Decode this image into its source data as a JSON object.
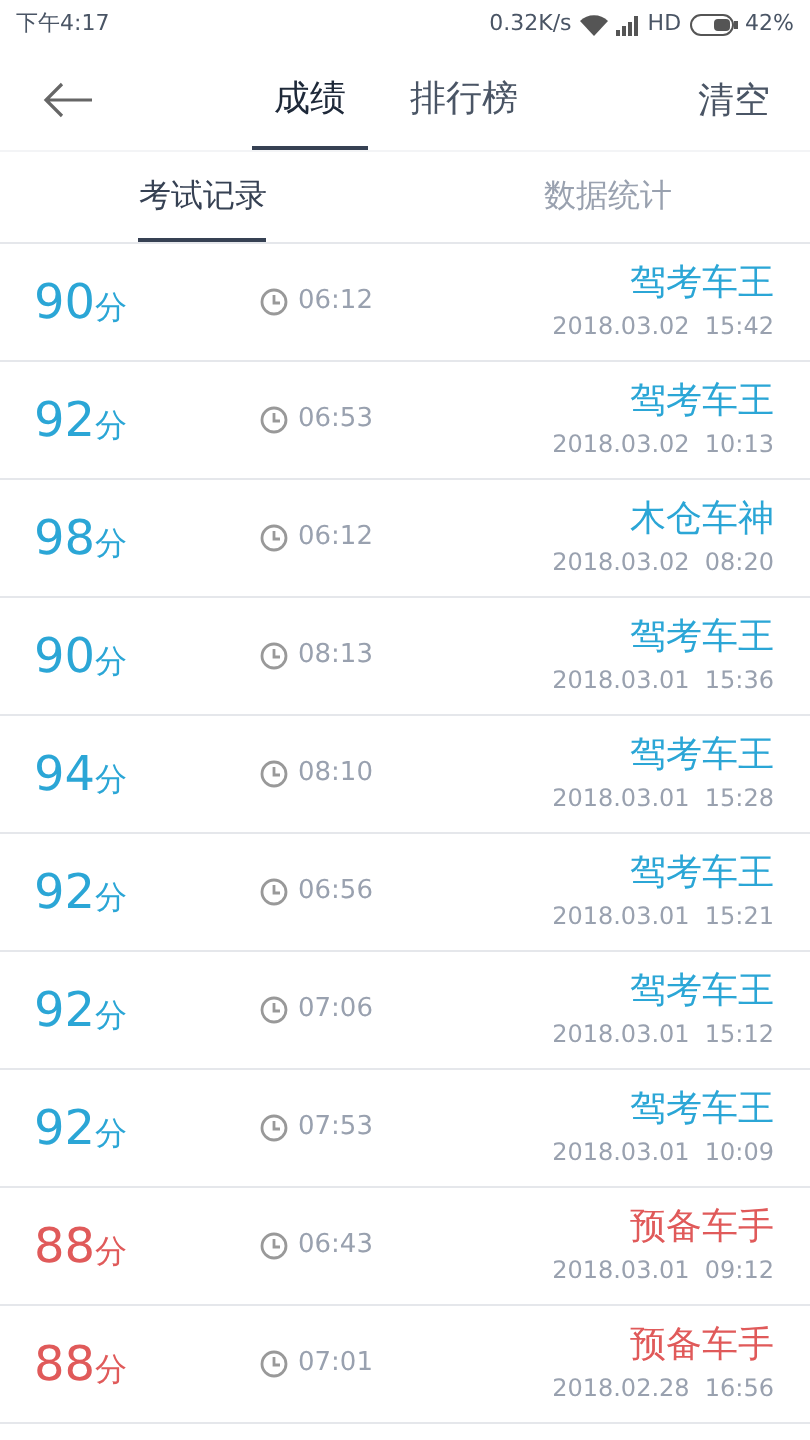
{
  "status_bar": {
    "time": "下午4:17",
    "speed": "0.32K/s",
    "network": "HD",
    "battery": "42%"
  },
  "header": {
    "tabs": [
      {
        "label": "成绩",
        "selected": true
      },
      {
        "label": "排行榜",
        "selected": false
      }
    ],
    "action": "清空"
  },
  "sub_tabs": [
    {
      "label": "考试记录",
      "selected": true
    },
    {
      "label": "数据统计",
      "selected": false
    }
  ],
  "records": [
    {
      "score": "90",
      "unit": "分",
      "duration": "06:12",
      "rank": "驾考车王",
      "date": "2018.03.02  15:42",
      "passed": true
    },
    {
      "score": "92",
      "unit": "分",
      "duration": "06:53",
      "rank": "驾考车王",
      "date": "2018.03.02  10:13",
      "passed": true
    },
    {
      "score": "98",
      "unit": "分",
      "duration": "06:12",
      "rank": "木仓车神",
      "date": "2018.03.02  08:20",
      "passed": true
    },
    {
      "score": "90",
      "unit": "分",
      "duration": "08:13",
      "rank": "驾考车王",
      "date": "2018.03.01  15:36",
      "passed": true
    },
    {
      "score": "94",
      "unit": "分",
      "duration": "08:10",
      "rank": "驾考车王",
      "date": "2018.03.01  15:28",
      "passed": true
    },
    {
      "score": "92",
      "unit": "分",
      "duration": "06:56",
      "rank": "驾考车王",
      "date": "2018.03.01  15:21",
      "passed": true
    },
    {
      "score": "92",
      "unit": "分",
      "duration": "07:06",
      "rank": "驾考车王",
      "date": "2018.03.01  15:12",
      "passed": true
    },
    {
      "score": "92",
      "unit": "分",
      "duration": "07:53",
      "rank": "驾考车王",
      "date": "2018.03.01  10:09",
      "passed": true
    },
    {
      "score": "88",
      "unit": "分",
      "duration": "06:43",
      "rank": "预备车手",
      "date": "2018.03.01  09:12",
      "passed": false
    },
    {
      "score": "88",
      "unit": "分",
      "duration": "07:01",
      "rank": "预备车手",
      "date": "2018.02.28  16:56",
      "passed": false
    }
  ]
}
